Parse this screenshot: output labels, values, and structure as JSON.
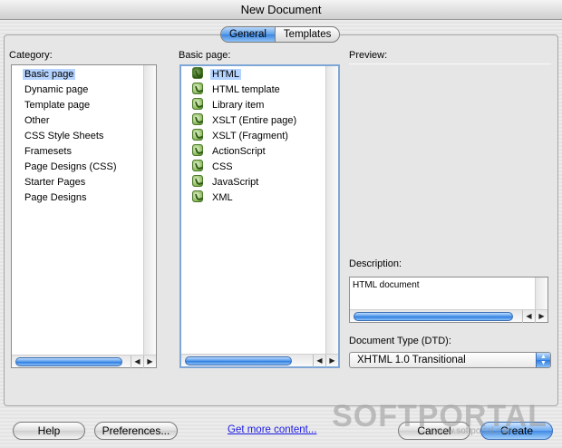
{
  "window": {
    "title": "New Document"
  },
  "tabs": [
    {
      "label": "General",
      "active": true
    },
    {
      "label": "Templates",
      "active": false
    }
  ],
  "category": {
    "label": "Category:",
    "items": [
      {
        "label": "Basic page",
        "selected": true
      },
      {
        "label": "Dynamic page"
      },
      {
        "label": "Template page"
      },
      {
        "label": "Other"
      },
      {
        "label": "CSS Style Sheets"
      },
      {
        "label": "Framesets"
      },
      {
        "label": "Page Designs (CSS)"
      },
      {
        "label": "Starter Pages"
      },
      {
        "label": "Page Designs"
      }
    ]
  },
  "basic_page": {
    "label": "Basic page:",
    "items": [
      {
        "label": "HTML",
        "selected": true
      },
      {
        "label": "HTML template"
      },
      {
        "label": "Library item"
      },
      {
        "label": "XSLT (Entire page)"
      },
      {
        "label": "XSLT (Fragment)"
      },
      {
        "label": "ActionScript"
      },
      {
        "label": "CSS"
      },
      {
        "label": "JavaScript"
      },
      {
        "label": "XML"
      }
    ]
  },
  "preview": {
    "label": "Preview:"
  },
  "description": {
    "label": "Description:",
    "text": "HTML document"
  },
  "doctype": {
    "label": "Document Type (DTD):",
    "value": "XHTML 1.0 Transitional"
  },
  "footer": {
    "help": "Help",
    "preferences": "Preferences...",
    "more_link": "Get more content...",
    "cancel": "Cancel",
    "create": "Create"
  },
  "watermark": {
    "brand": "SOFTPORTAL",
    "url": "www.softportal.com"
  },
  "icons": {
    "file": "dreamweaver-file-icon",
    "scroll_left": "scroll-left-arrow-icon",
    "scroll_right": "scroll-right-arrow-icon",
    "select_caret": "updown-caret-icon"
  }
}
